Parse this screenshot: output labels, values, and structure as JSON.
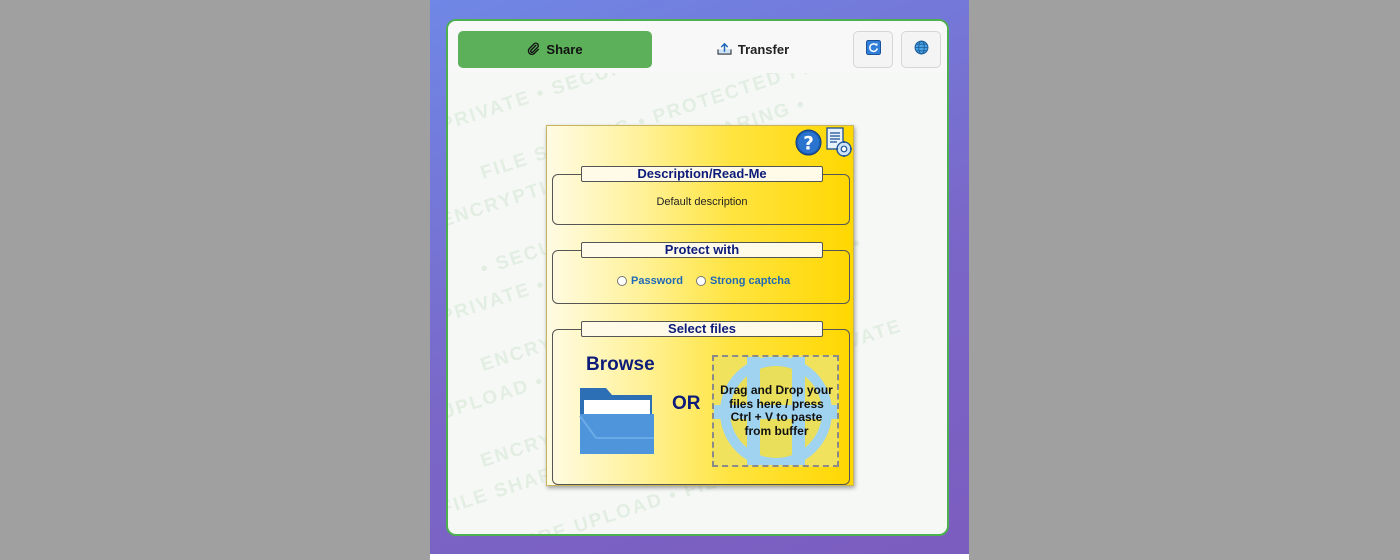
{
  "tabs": {
    "share_label": "Share",
    "transfer_label": "Transfer"
  },
  "header_icons": [
    "refresh-icon",
    "globe-icon"
  ],
  "watermark_words": [
    "PRIVATE • SECURE • ENCRYPTION",
    "FILE SHARING • PROTECTED FILES",
    "ENCRYPTION • SECURE SHARING •",
    "• SECURE • PRIVATE • UPLOAD •",
    "PRIVATE • ENCRYPTION • SECURE",
    "ENCRYPTION • UPLOAD • SHARING •",
    "UPLOAD • SECURE • PRIVATE FILE •",
    "ENCRYPTION • FILE SHARING • PRIVATE",
    "FILE SHARING • FILE ENCRYPTION •",
    "SECURE UPLOAD • FILES • SECURE"
  ],
  "panel": {
    "help_icon": "help-icon",
    "doc_icon": "document-settings-icon",
    "description": {
      "legend": "Description/Read-Me",
      "text": "Default description"
    },
    "protect": {
      "legend": "Protect with",
      "options": [
        "Password",
        "Strong captcha"
      ]
    },
    "select": {
      "legend": "Select files",
      "browse_label": "Browse",
      "or_label": "OR",
      "dropzone_text": "Drag and Drop your files here / press Ctrl + V to paste from buffer"
    }
  },
  "colors": {
    "share_tab": "#5cb05a",
    "card_border": "#4caf50",
    "legend_text": "#0d1b7a",
    "radio_label": "#1f69b6"
  }
}
